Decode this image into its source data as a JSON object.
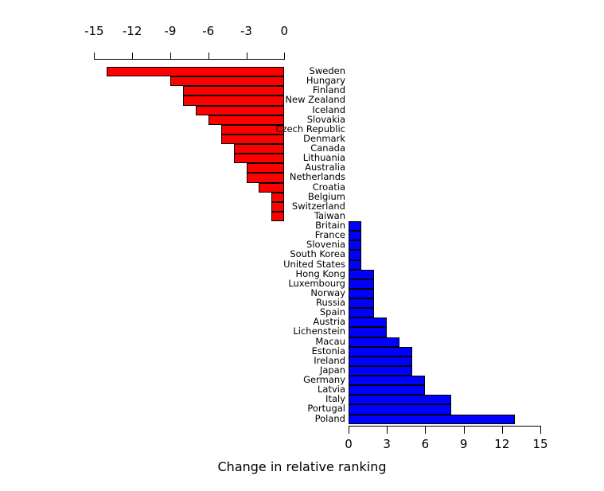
{
  "chart_data": {
    "type": "bar",
    "orientation": "horizontal",
    "title": "",
    "xlabel": "Change in relative ranking",
    "ylabel": "",
    "grid": false,
    "legend": null,
    "top_axis": {
      "ticks": [
        "-15",
        "-12",
        "-9",
        "-6",
        "-3",
        "0"
      ],
      "min": -15,
      "max": 0
    },
    "bottom_axis": {
      "ticks": [
        "0",
        "3",
        "6",
        "9",
        "12",
        "15"
      ],
      "min": 0,
      "max": 15
    },
    "colors": {
      "negative": "#ff0000",
      "positive": "#0000ff",
      "outline": "#000000",
      "background": "#ffffff"
    },
    "categories": [
      "Sweden",
      "Hungary",
      "Finland",
      "New Zealand",
      "Iceland",
      "Slovakia",
      "Czech Republic",
      "Denmark",
      "Canada",
      "Lithuania",
      "Australia",
      "Netherlands",
      "Croatia",
      "Belgium",
      "Switzerland",
      "Taiwan",
      "Britain",
      "France",
      "Slovenia",
      "South Korea",
      "United States",
      "Hong Kong",
      "Luxembourg",
      "Norway",
      "Russia",
      "Spain",
      "Austria",
      "Lichenstein",
      "Macau",
      "Estonia",
      "Ireland",
      "Japan",
      "Germany",
      "Latvia",
      "Italy",
      "Portugal",
      "Poland"
    ],
    "values": [
      -14,
      -9,
      -8,
      -8,
      -7,
      -6,
      -5,
      -5,
      -4,
      -4,
      -3,
      -3,
      -2,
      -1,
      -1,
      -1,
      1,
      1,
      1,
      1,
      1,
      2,
      2,
      2,
      2,
      2,
      3,
      3,
      4,
      5,
      5,
      5,
      6,
      6,
      8,
      8,
      13
    ]
  }
}
